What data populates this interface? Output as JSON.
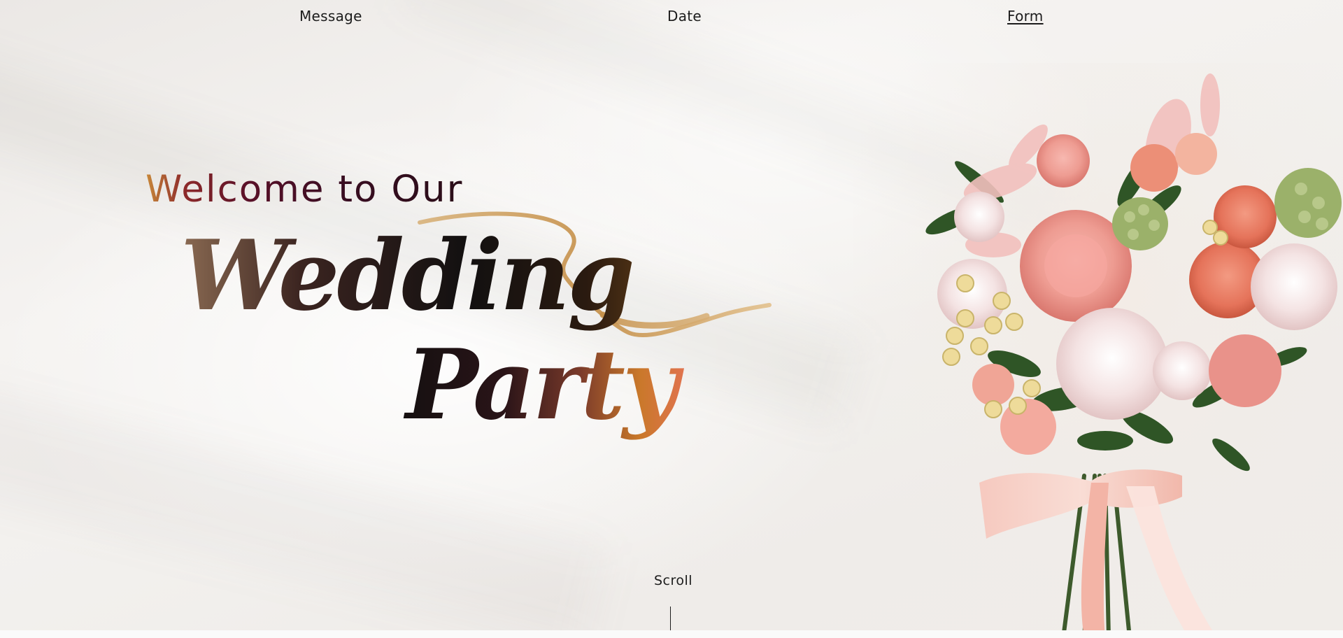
{
  "nav": {
    "message_label": "Message",
    "date_label": "Date",
    "form_label": "Form"
  },
  "hero": {
    "welcome_text": "Welcome to Our",
    "script_word_1": "Wedding",
    "script_word_2": "Party"
  },
  "scroll": {
    "label": "Scroll"
  },
  "colors": {
    "text": "#1c1c1c",
    "background": "#f1efec",
    "gold": "#c99a5a",
    "burgundy": "#5a1028",
    "peach": "#e8896a"
  },
  "icons": {
    "scroll_indicator": "vertical-line",
    "bouquet": "flower-bouquet-image"
  }
}
